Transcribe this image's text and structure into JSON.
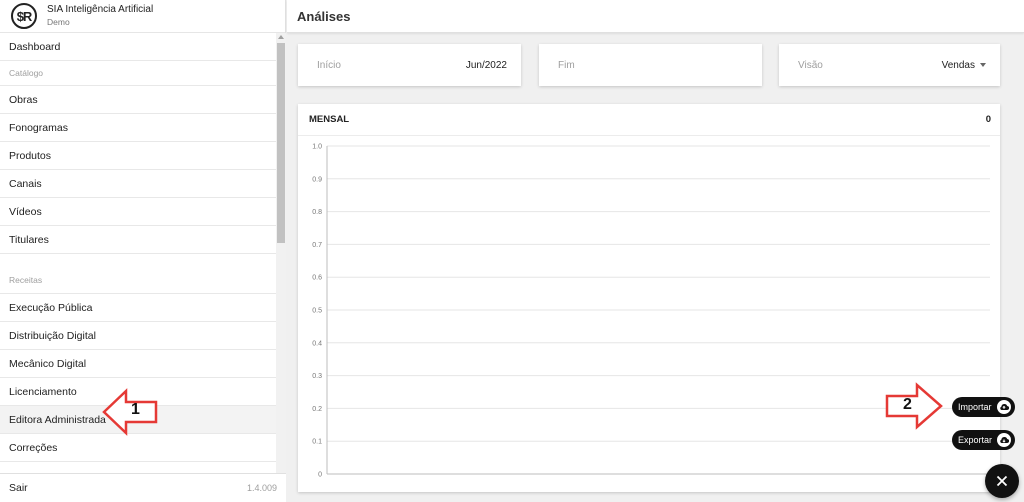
{
  "brand": {
    "logo_text": "$R",
    "name": "SIA Inteligência Artificial",
    "subtitle": "Demo"
  },
  "sidebar": {
    "items": [
      {
        "type": "item",
        "label": "Dashboard"
      },
      {
        "type": "header",
        "label": "Catálogo"
      },
      {
        "type": "item",
        "label": "Obras"
      },
      {
        "type": "item",
        "label": "Fonogramas"
      },
      {
        "type": "item",
        "label": "Produtos"
      },
      {
        "type": "item",
        "label": "Canais"
      },
      {
        "type": "item",
        "label": "Vídeos"
      },
      {
        "type": "item",
        "label": "Titulares"
      },
      {
        "type": "header",
        "label": "Receitas"
      },
      {
        "type": "item",
        "label": "Execução Pública"
      },
      {
        "type": "item",
        "label": "Distribuição Digital"
      },
      {
        "type": "item",
        "label": "Mecânico Digital"
      },
      {
        "type": "item",
        "label": "Licenciamento"
      },
      {
        "type": "item",
        "label": "Editora Administrada",
        "active": true
      },
      {
        "type": "item",
        "label": "Correções"
      }
    ],
    "footer": {
      "logout_label": "Sair",
      "version": "1.4.009"
    }
  },
  "header": {
    "title": "Análises"
  },
  "filters": {
    "start": {
      "label": "Início",
      "value": "Jun/2022"
    },
    "end": {
      "label": "Fim",
      "value": ""
    },
    "view": {
      "label": "Visão",
      "value": "Vendas"
    }
  },
  "panel": {
    "title": "MENSAL",
    "total": "0"
  },
  "chart_data": {
    "type": "line",
    "title": "MENSAL",
    "x": [],
    "series": [],
    "ylim": [
      0,
      1.0
    ],
    "yticks": [
      "0",
      "0.1",
      "0.2",
      "0.3",
      "0.4",
      "0.5",
      "0.6",
      "0.7",
      "0.8",
      "0.9",
      "1.0"
    ],
    "grid": true
  },
  "actions": {
    "import_label": "Importar",
    "export_label": "Exportar",
    "close_icon": "close-icon"
  },
  "annotations": {
    "callout_1": "1",
    "callout_2": "2",
    "color": "#e53935"
  }
}
